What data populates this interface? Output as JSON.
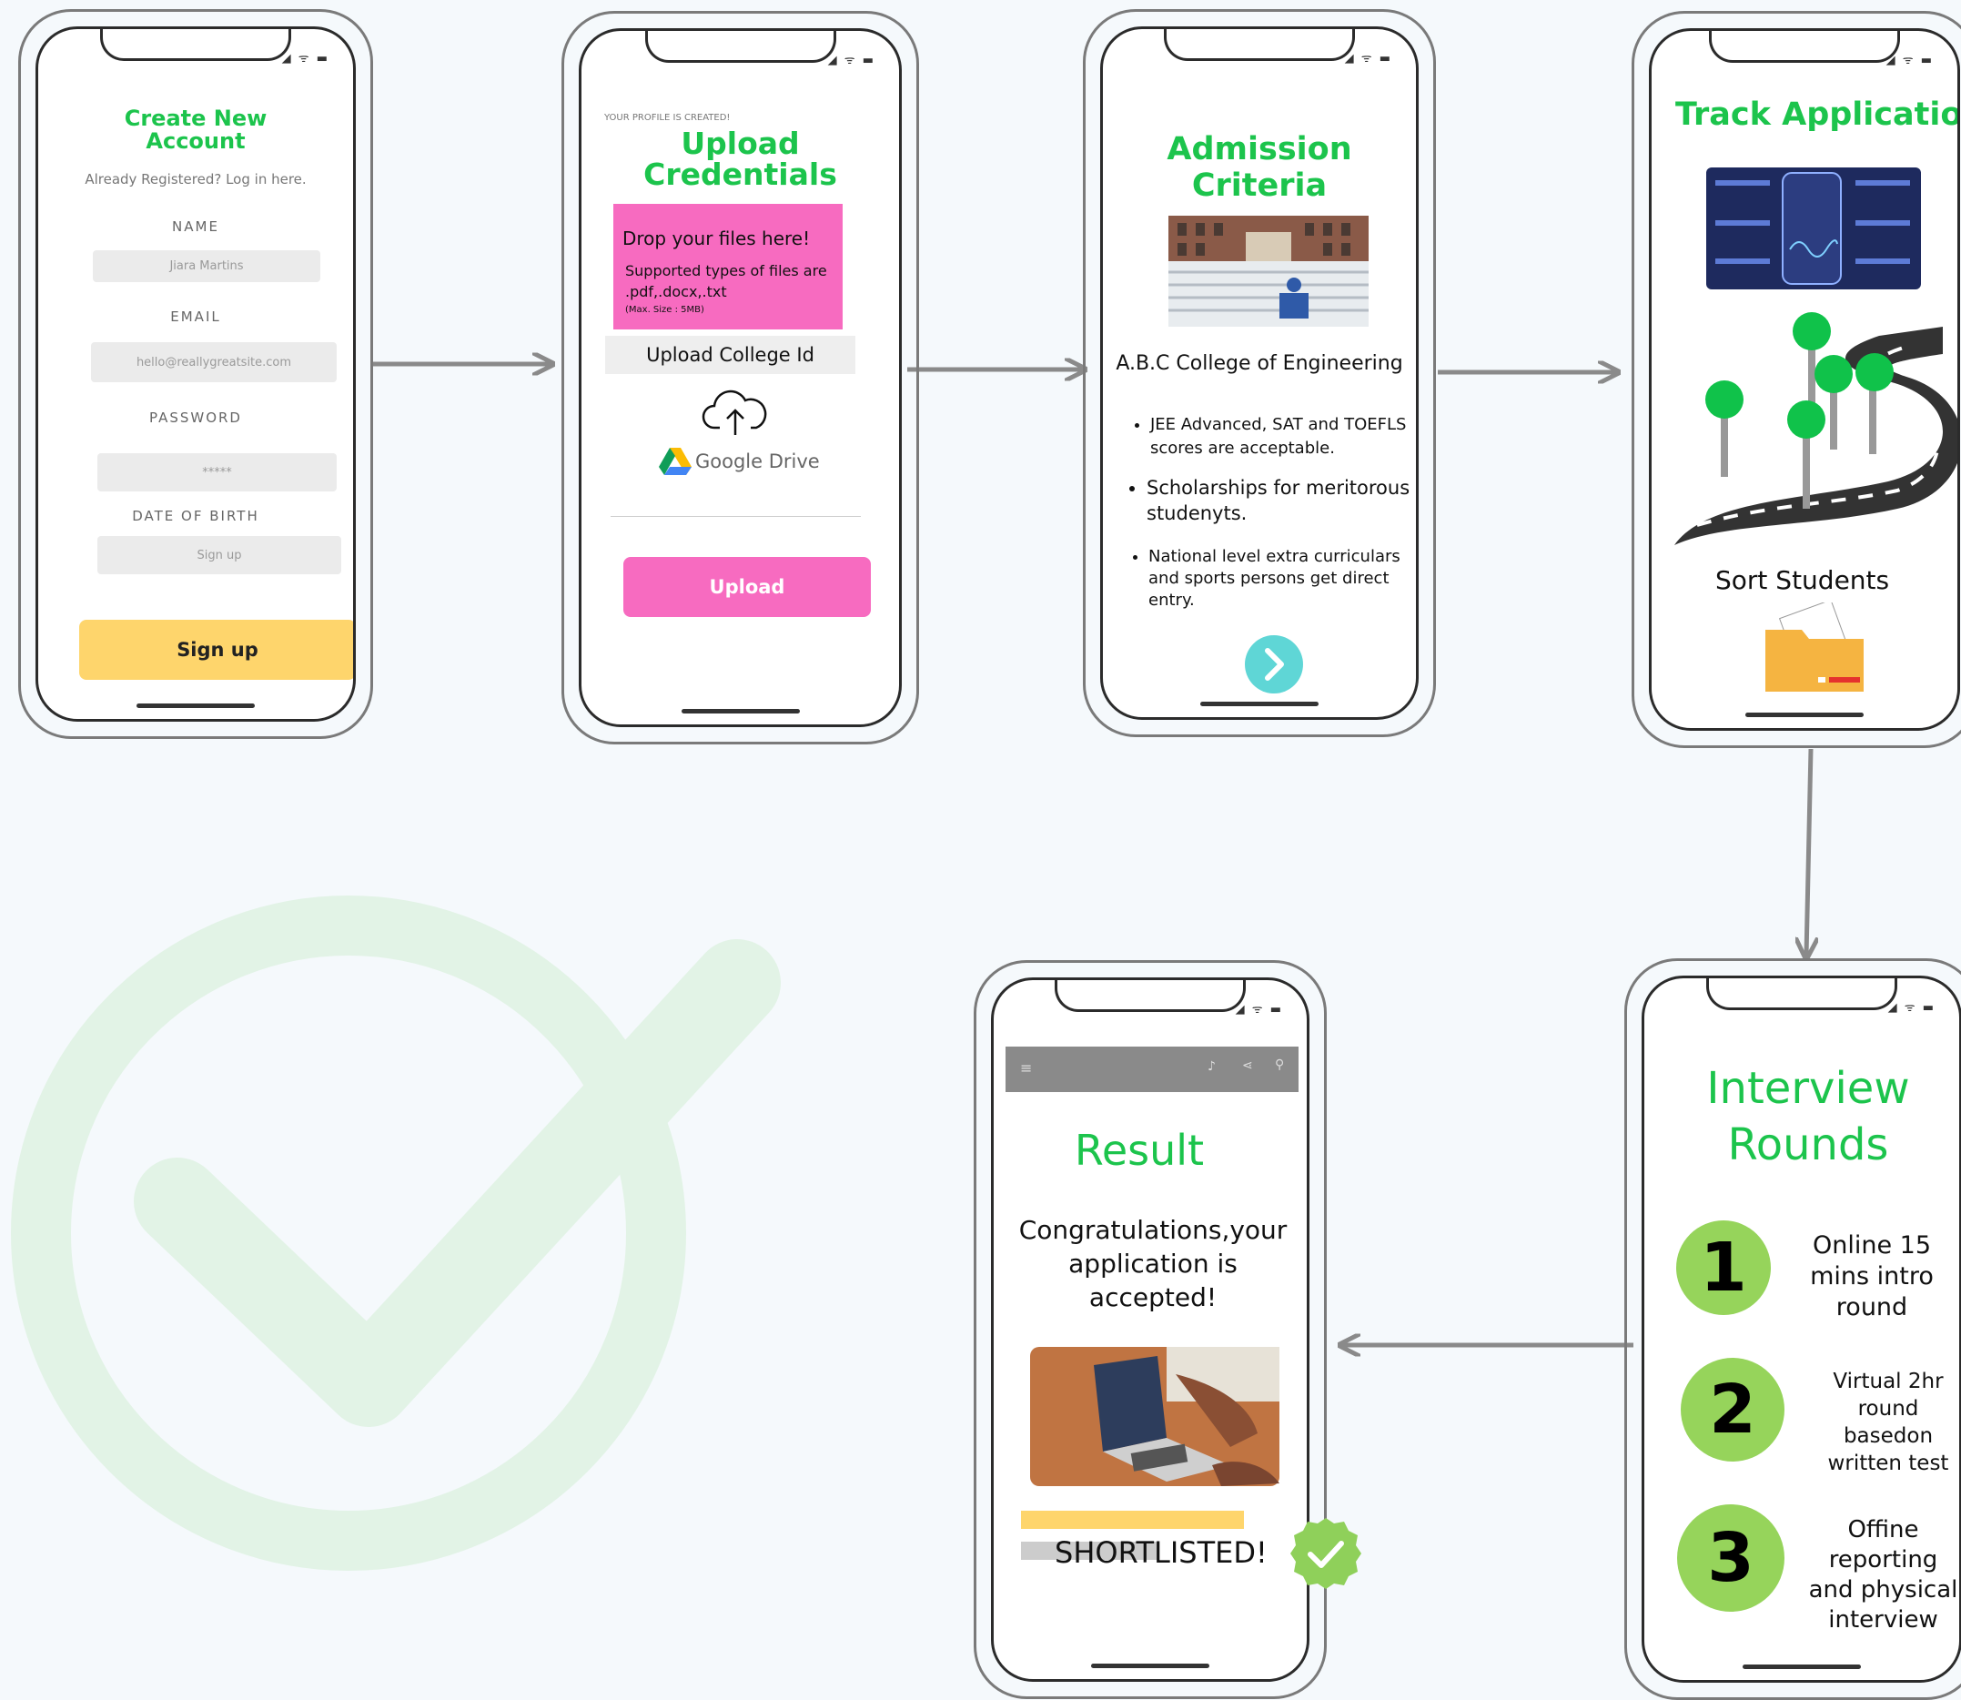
{
  "status_icons": "◢ ᯤ ▬",
  "screens": {
    "create_account": {
      "title_line1": "Create New",
      "title_line2": "Account",
      "subtitle": "Already Registered? Log in here.",
      "name_label": "NAME",
      "name_value": "Jiara Martins",
      "email_label": "EMAIL",
      "email_value": "hello@reallygreatsite.com",
      "password_label": "PASSWORD",
      "password_value": "*****",
      "dob_label": "DATE OF BIRTH",
      "dob_value": "Sign up",
      "button": "Sign up"
    },
    "upload": {
      "notice": "YOUR PROFILE IS CREATED!",
      "title_line1": "Upload",
      "title_line2": "Credentials",
      "drop_title": "Drop your files here!",
      "drop_types": "Supported types of files are .pdf,.docx,.txt",
      "drop_size": "(Max. Size : 5MB)",
      "college_id": "Upload College Id",
      "gdrive": "Google Drive",
      "button": "Upload"
    },
    "admission": {
      "title": "Admission Criteria",
      "college": "A.B.C College of Engineering",
      "bullets": [
        "JEE Advanced, SAT and TOEFLS scores are acceptable.",
        "Scholarships for meritorous studenyts.",
        "National level extra curriculars and sports persons get direct entry."
      ]
    },
    "track": {
      "title": "Track Application",
      "sort": "Sort Students"
    },
    "interview": {
      "title_line1": "Interview",
      "title_line2": "Rounds",
      "rounds": [
        {
          "num": "1",
          "text": "Online  15 mins intro round"
        },
        {
          "num": "2",
          "text": "Virtual 2hr round basedon written test"
        },
        {
          "num": "3",
          "text": "Offine reporting and physical interview"
        }
      ]
    },
    "result": {
      "title": "Result",
      "message": "Congratulations,your application is accepted!",
      "status": "SHORTLISTED!"
    }
  },
  "colors": {
    "accent_green": "#1cc44c",
    "pink": "#f76bc0",
    "yellow": "#fed56c",
    "teal": "#5fd6d6",
    "round_green": "#96d45b"
  }
}
